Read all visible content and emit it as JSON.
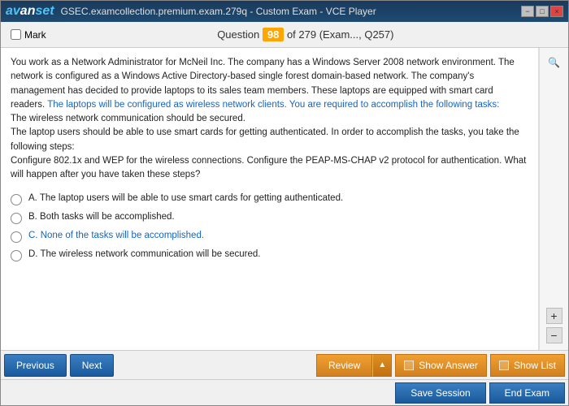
{
  "window": {
    "title": "GSEC.examcollection.premium.exam.279q - Custom Exam - VCE Player",
    "logo": "avanset",
    "controls": [
      "−",
      "□",
      "×"
    ]
  },
  "header": {
    "mark_label": "Mark",
    "question_number": "98",
    "question_total": "of 279",
    "exam_info": "(Exam..., Q257)"
  },
  "question": {
    "body": "You work as a Network Administrator for McNeil Inc. The company has a Windows Server 2008 network environment. The network is configured as a Windows Active Directory-based single forest domain-based network. The company's management has decided to provide laptops to its sales team members. These laptops are equipped with smart card readers. The laptops will be configured as wireless network clients. You are required to accomplish the following tasks:\nThe wireless network communication should be secured.\nThe laptop users should be able to use smart cards for getting authenticated. In order to accomplish the tasks, you take the following steps:\nConfigure 802.1x and WEP for the wireless connections. Configure the PEAP-MS-CHAP v2 protocol for authentication. What will happen after you have taken these steps?",
    "options": [
      {
        "letter": "A",
        "text": "The laptop users will be able to use smart cards for getting authenticated.",
        "color": "normal"
      },
      {
        "letter": "B",
        "text": "Both tasks will be accomplished.",
        "color": "normal"
      },
      {
        "letter": "C",
        "text": "None of the tasks will be accomplished.",
        "color": "blue"
      },
      {
        "letter": "D",
        "text": "The wireless network communication will be secured.",
        "color": "normal"
      }
    ]
  },
  "toolbar1": {
    "previous_label": "Previous",
    "next_label": "Next",
    "review_label": "Review",
    "show_answer_label": "Show Answer",
    "show_list_label": "Show List"
  },
  "toolbar2": {
    "save_session_label": "Save Session",
    "end_exam_label": "End Exam"
  },
  "sidebar": {
    "search_icon": "🔍",
    "zoom_in": "+",
    "zoom_out": "−"
  }
}
